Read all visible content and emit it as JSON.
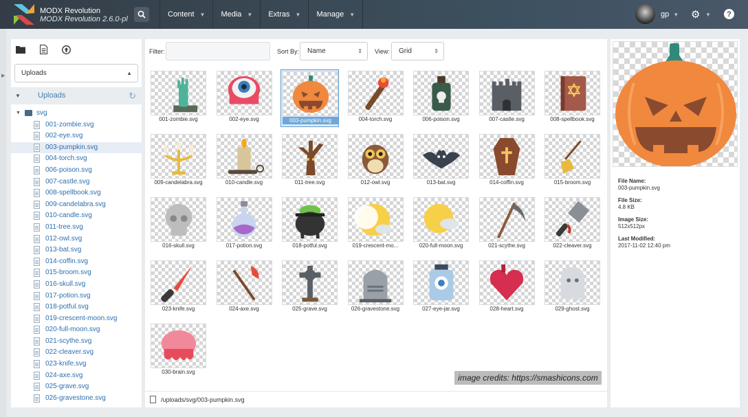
{
  "app": {
    "name": "MODX Revolution",
    "version": "MODX Revolution 2.6.0-pl"
  },
  "nav": [
    {
      "label": "Content"
    },
    {
      "label": "Media"
    },
    {
      "label": "Extras"
    },
    {
      "label": "Manage"
    }
  ],
  "user": {
    "name": "gp"
  },
  "sidebar": {
    "source_select": "Uploads",
    "root_label": "Uploads",
    "folder": "svg",
    "files": [
      "001-zombie.svg",
      "002-eye.svg",
      "003-pumpkin.svg",
      "004-torch.svg",
      "006-poison.svg",
      "007-castle.svg",
      "008-spellbook.svg",
      "009-candelabra.svg",
      "010-candle.svg",
      "011-tree.svg",
      "012-owl.svg",
      "013-bat.svg",
      "014-coffin.svg",
      "015-broom.svg",
      "016-skull.svg",
      "017-potion.svg",
      "018-potful.svg",
      "019-crescent-moon.svg",
      "020-full-moon.svg",
      "021-scythe.svg",
      "022-cleaver.svg",
      "023-knife.svg",
      "024-axe.svg",
      "025-grave.svg",
      "026-gravestone.svg"
    ],
    "selected_index": 2
  },
  "toolbar": {
    "filter_label": "Filter:",
    "filter_value": "",
    "sort_label": "Sort By:",
    "sort_value": "Name",
    "view_label": "View:",
    "view_value": "Grid"
  },
  "grid": {
    "items": [
      {
        "name": "001-zombie.svg",
        "icon": "zombie-hand-icon"
      },
      {
        "name": "002-eye.svg",
        "icon": "eye-icon"
      },
      {
        "name": "003-pumpkin.svg",
        "icon": "pumpkin-icon"
      },
      {
        "name": "004-torch.svg",
        "icon": "torch-icon"
      },
      {
        "name": "006-poison.svg",
        "icon": "poison-icon"
      },
      {
        "name": "007-castle.svg",
        "icon": "castle-icon"
      },
      {
        "name": "008-spellbook.svg",
        "icon": "spellbook-icon"
      },
      {
        "name": "009-candelabra.svg",
        "icon": "candelabra-icon"
      },
      {
        "name": "010-candle.svg",
        "icon": "candle-icon"
      },
      {
        "name": "011-tree.svg",
        "icon": "tree-icon"
      },
      {
        "name": "012-owl.svg",
        "icon": "owl-icon"
      },
      {
        "name": "013-bat.svg",
        "icon": "bat-icon"
      },
      {
        "name": "014-coffin.svg",
        "icon": "coffin-icon"
      },
      {
        "name": "015-broom.svg",
        "icon": "broom-icon"
      },
      {
        "name": "016-skull.svg",
        "icon": "skull-icon"
      },
      {
        "name": "017-potion.svg",
        "icon": "potion-icon"
      },
      {
        "name": "018-potful.svg",
        "icon": "cauldron-icon"
      },
      {
        "name": "019-crescent-mo...",
        "icon": "crescent-moon-icon"
      },
      {
        "name": "020-full-moon.svg",
        "icon": "full-moon-icon"
      },
      {
        "name": "021-scythe.svg",
        "icon": "scythe-icon"
      },
      {
        "name": "022-cleaver.svg",
        "icon": "cleaver-icon"
      },
      {
        "name": "023-knife.svg",
        "icon": "knife-icon"
      },
      {
        "name": "024-axe.svg",
        "icon": "axe-icon"
      },
      {
        "name": "025-grave.svg",
        "icon": "grave-cross-icon"
      },
      {
        "name": "026-gravestone.svg",
        "icon": "gravestone-icon"
      },
      {
        "name": "027-eye-jar.svg",
        "icon": "eye-jar-icon"
      },
      {
        "name": "028-heart.svg",
        "icon": "heart-icon"
      },
      {
        "name": "029-ghost.svg",
        "icon": "ghost-icon"
      },
      {
        "name": "030-brain.svg",
        "icon": "brain-icon"
      }
    ],
    "selected_index": 2
  },
  "credits": "image credits: https://smashicons.com",
  "path": "/uploads/svg/003-pumpkin.svg",
  "preview": {
    "file_name_label": "File Name:",
    "file_name": "003-pumpkin.svg",
    "file_size_label": "File Size:",
    "file_size": "4.8 KB",
    "image_size_label": "Image Size:",
    "image_size": "512x512px",
    "modified_label": "Last Modified:",
    "modified": "2017-11-02 12:40 pm"
  },
  "colors": {
    "accent": "#5a9bd4",
    "pumpkin": "#f0883e",
    "stem": "#2f8a7a",
    "link": "#2c6fb0"
  }
}
